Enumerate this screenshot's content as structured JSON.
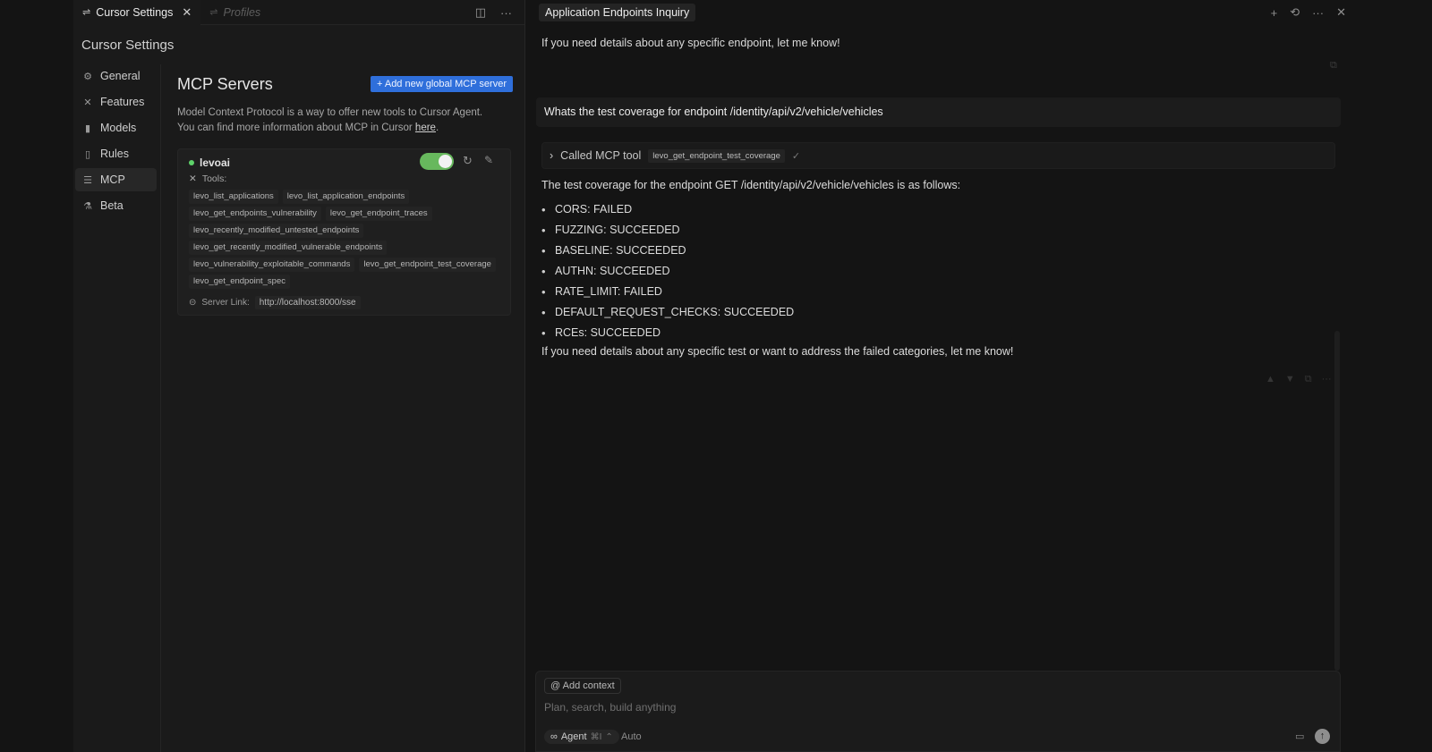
{
  "settings_tab": {
    "label": "Cursor Settings",
    "close": "✕"
  },
  "profiles_tab": {
    "label": "Profiles"
  },
  "settings": {
    "title": "Cursor Settings",
    "nav": [
      "General",
      "Features",
      "Models",
      "Rules",
      "MCP",
      "Beta"
    ],
    "active_nav": "MCP"
  },
  "mcp": {
    "title": "MCP Servers",
    "add_button": "+ Add new global MCP server",
    "description_1": "Model Context Protocol is a way to offer new tools to Cursor Agent.",
    "description_2": "You can find more information about MCP in Cursor ",
    "description_link": "here",
    "description_end": ".",
    "server": {
      "name": "levoai",
      "status_color": "#5ed36a",
      "enabled": true,
      "tools_label": "Tools:",
      "tools": [
        "levo_list_applications",
        "levo_list_application_endpoints",
        "levo_get_endpoints_vulnerability",
        "levo_get_endpoint_traces",
        "levo_recently_modified_untested_endpoints",
        "levo_get_recently_modified_vulnerable_endpoints",
        "levo_vulnerability_exploitable_commands",
        "levo_get_endpoint_test_coverage",
        "levo_get_endpoint_spec"
      ],
      "link_label": "Server Link:",
      "link_url": "http://localhost:8000/sse"
    }
  },
  "chat": {
    "title": "Application Endpoints Inquiry",
    "previous_message": "If you need details about any specific endpoint, let me know!",
    "user_message": "Whats the test coverage for endpoint /identity/api/v2/vehicle/vehicles",
    "tool_call": {
      "label": "Called MCP tool",
      "tool": "levo_get_endpoint_test_coverage",
      "check": "✓"
    },
    "answer_intro": "The test coverage for the endpoint GET /identity/api/v2/vehicle/vehicles is as follows:",
    "results": [
      "CORS: FAILED",
      "FUZZING: SUCCEEDED",
      "BASELINE: SUCCEEDED",
      "AUTHN: SUCCEEDED",
      "RATE_LIMIT: FAILED",
      "DEFAULT_REQUEST_CHECKS: SUCCEEDED",
      "RCEs: SUCCEEDED"
    ],
    "answer_outro": "If you need details about any specific test or want to address the failed categories, let me know!"
  },
  "composer": {
    "context_button": "@ Add context",
    "placeholder": "Plan, search, build anything",
    "agent_label": "Agent",
    "agent_shortcut": "⌘I",
    "model_label": "Auto"
  }
}
